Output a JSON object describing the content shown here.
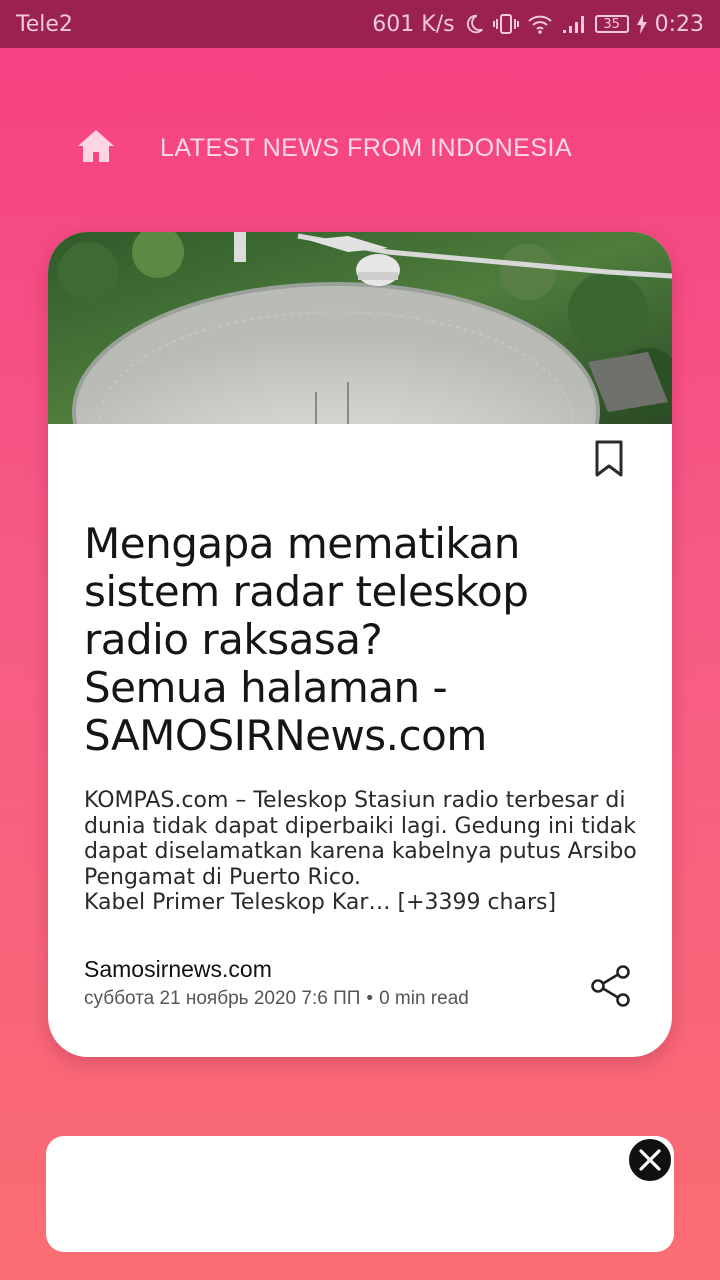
{
  "status_bar": {
    "carrier": "Tele2",
    "net_speed": "601 K/s",
    "battery": "35",
    "time": "0:23",
    "icons": [
      "moon-icon",
      "vibrate-icon",
      "wifi-icon",
      "signal-icon",
      "battery-icon",
      "charging-icon"
    ]
  },
  "header": {
    "icon": "home-icon",
    "title": "LATEST NEWS FROM INDONESIA"
  },
  "article": {
    "image_icon": "radio-telescope-photo",
    "title": "Mengapa mematikan sistem radar teleskop radio raksasa?\nSemua halaman - SAMOSIRNews.com",
    "summary": "KOMPAS.com – Teleskop Stasiun radio terbesar di dunia tidak dapat diperbaiki lagi. Gedung ini tidak dapat diselamatkan karena kabelnya putus Arsibo Pengamat di Puerto Rico.\nKabel Primer Teleskop Kar… [+3399 chars]",
    "source": "Samosirnews.com",
    "date": "суббота 21 ноябрь 2020 7:6 ПП",
    "separator": "•",
    "read_time": "0 min read",
    "bookmark_icon": "bookmark-icon",
    "share_icon": "share-icon"
  },
  "ad": {
    "close_icon": "close-icon"
  },
  "colors": {
    "gradient_top": "#f63f82",
    "gradient_bottom": "#fb6d72",
    "status_bar": "#9a2150"
  }
}
